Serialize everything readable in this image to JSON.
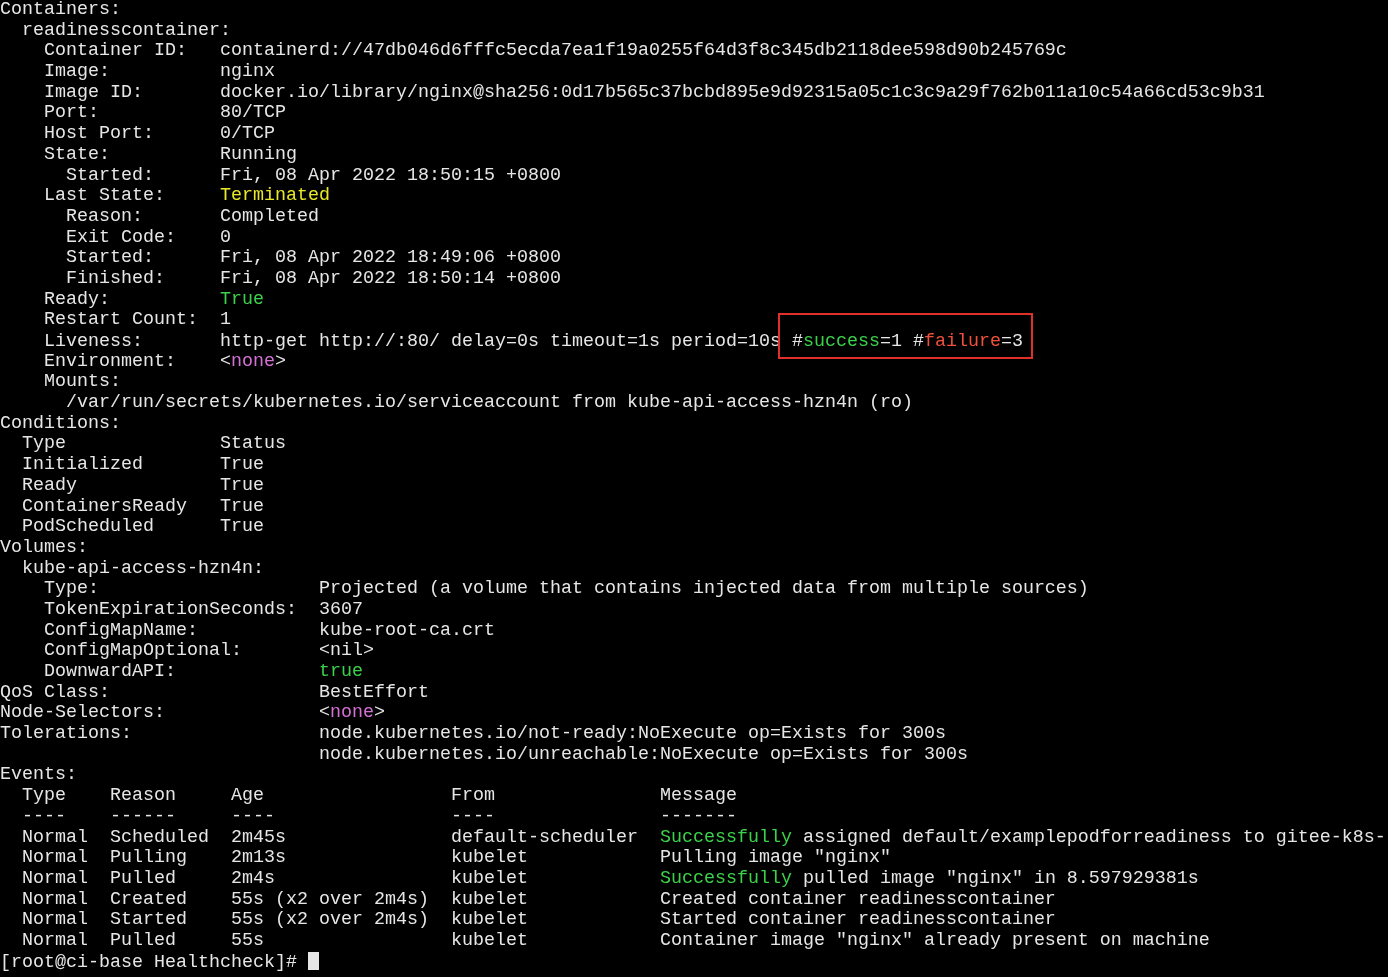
{
  "terminal": {
    "lines": [
      {
        "text": "Containers:"
      },
      {
        "text": "  readinesscontainer:"
      },
      {
        "text": "    Container ID:   containerd://47db046d6fffc5ecda7ea1f19a0255f64d3f8c345db2118dee598d90b245769c"
      },
      {
        "text": "    Image:          nginx"
      },
      {
        "text": "    Image ID:       docker.io/library/nginx@sha256:0d17b565c37bcbd895e9d92315a05c1c3c9a29f762b011a10c54a66cd53c9b31"
      },
      {
        "text": "    Port:           80/TCP"
      },
      {
        "text": "    Host Port:      0/TCP"
      },
      {
        "text": "    State:          Running"
      },
      {
        "text": "      Started:      Fri, 08 Apr 2022 18:50:15 +0800"
      },
      {
        "segments": [
          {
            "text": "    Last State:     ",
            "kind": "text"
          },
          {
            "text": "Terminated",
            "kind": "warn"
          }
        ]
      },
      {
        "text": "      Reason:       Completed"
      },
      {
        "text": "      Exit Code:    0"
      },
      {
        "text": "      Started:      Fri, 08 Apr 2022 18:49:06 +0800"
      },
      {
        "text": "      Finished:     Fri, 08 Apr 2022 18:50:14 +0800"
      },
      {
        "segments": [
          {
            "text": "    Ready:          ",
            "kind": "text"
          },
          {
            "text": "True",
            "kind": "ok"
          }
        ]
      },
      {
        "text": "    Restart Count:  1"
      },
      {
        "segments": [
          {
            "text": "    Liveness:       http-get http://:80/ delay=0s timeout=1s period=10s ",
            "kind": "text"
          },
          {
            "text": "#",
            "kind": "text",
            "boxed": true
          },
          {
            "text": "success",
            "kind": "ok",
            "boxed": true
          },
          {
            "text": "=1 #",
            "kind": "text",
            "boxed": true
          },
          {
            "text": "failure",
            "kind": "fail",
            "boxed": true
          },
          {
            "text": "=3",
            "kind": "text",
            "boxed": true
          }
        ]
      },
      {
        "segments": [
          {
            "text": "    Environment:    <",
            "kind": "text"
          },
          {
            "text": "none",
            "kind": "nil"
          },
          {
            "text": ">",
            "kind": "text"
          }
        ]
      },
      {
        "text": "    Mounts:"
      },
      {
        "text": "      /var/run/secrets/kubernetes.io/serviceaccount from kube-api-access-hzn4n (ro)"
      },
      {
        "text": "Conditions:"
      },
      {
        "text": "  Type              Status"
      },
      {
        "text": "  Initialized       True"
      },
      {
        "text": "  Ready             True"
      },
      {
        "text": "  ContainersReady   True"
      },
      {
        "text": "  PodScheduled      True"
      },
      {
        "text": "Volumes:"
      },
      {
        "text": "  kube-api-access-hzn4n:"
      },
      {
        "text": "    Type:                    Projected (a volume that contains injected data from multiple sources)"
      },
      {
        "text": "    TokenExpirationSeconds:  3607"
      },
      {
        "text": "    ConfigMapName:           kube-root-ca.crt"
      },
      {
        "text": "    ConfigMapOptional:       <nil>"
      },
      {
        "segments": [
          {
            "text": "    DownwardAPI:             ",
            "kind": "text"
          },
          {
            "text": "true",
            "kind": "ok"
          }
        ]
      },
      {
        "text": "QoS Class:                   BestEffort"
      },
      {
        "segments": [
          {
            "text": "Node-Selectors:              <",
            "kind": "text"
          },
          {
            "text": "none",
            "kind": "nil"
          },
          {
            "text": ">",
            "kind": "text"
          }
        ]
      },
      {
        "text": "Tolerations:                 node.kubernetes.io/not-ready:NoExecute op=Exists for 300s"
      },
      {
        "text": "                             node.kubernetes.io/unreachable:NoExecute op=Exists for 300s"
      },
      {
        "text": "Events:"
      },
      {
        "text": "  Type    Reason     Age                 From               Message"
      },
      {
        "text": "  ----    ------     ----                ----               -------"
      },
      {
        "segments": [
          {
            "text": "  Normal  Scheduled  2m45s               default-scheduler  ",
            "kind": "text"
          },
          {
            "text": "Successfully",
            "kind": "ok"
          },
          {
            "text": " assigned default/examplepodforreadiness to gitee-k8s-",
            "kind": "text"
          }
        ]
      },
      {
        "text": "  Normal  Pulling    2m13s               kubelet            Pulling image \"nginx\""
      },
      {
        "segments": [
          {
            "text": "  Normal  Pulled     2m4s                kubelet            ",
            "kind": "text"
          },
          {
            "text": "Successfully",
            "kind": "ok"
          },
          {
            "text": " pulled image \"nginx\" in 8.597929381s",
            "kind": "text"
          }
        ]
      },
      {
        "text": "  Normal  Created    55s (x2 over 2m4s)  kubelet            Created container readinesscontainer"
      },
      {
        "text": "  Normal  Started    55s (x2 over 2m4s)  kubelet            Started container readinesscontainer"
      },
      {
        "text": "  Normal  Pulled     55s                 kubelet            Container image \"nginx\" already present on machine"
      },
      {
        "text": "[root@ci-base Healthcheck]# ",
        "cursor": true
      }
    ]
  }
}
